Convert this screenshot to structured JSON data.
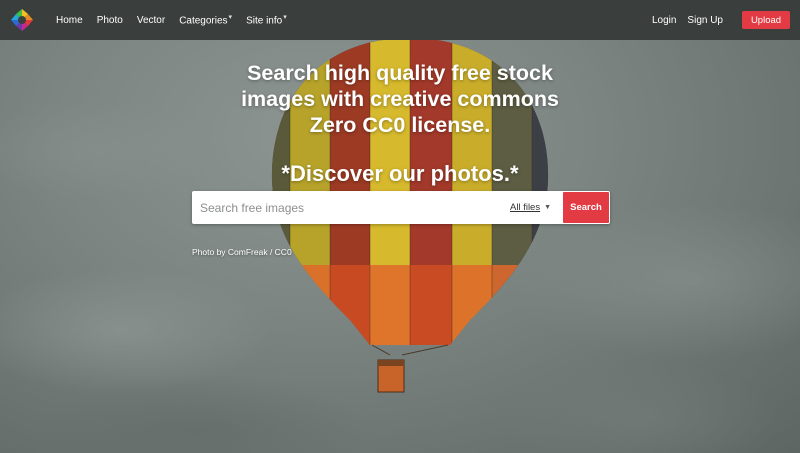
{
  "navbar": {
    "logo_icon": "camera-aperture-icon",
    "left_links": [
      {
        "label": "Home",
        "has_dropdown": false
      },
      {
        "label": "Photo",
        "has_dropdown": false
      },
      {
        "label": "Vector",
        "has_dropdown": false
      },
      {
        "label": "Categories",
        "has_dropdown": true
      },
      {
        "label": "Site info",
        "has_dropdown": true
      }
    ],
    "login_label": "Login",
    "signup_label": "Sign Up",
    "upload_label": "Upload"
  },
  "hero": {
    "title_lines": [
      "Search high quality free stock",
      "images with creative commons",
      "Zero CC0 license."
    ],
    "subtitle": "*Discover our photos.*",
    "search": {
      "placeholder": "Search free images",
      "value": "",
      "filter_label": "All files",
      "button_label": "Search"
    },
    "photo_credit": "Photo by ComFreak / CC0"
  },
  "colors": {
    "navbar_bg": "#3a3e3d",
    "accent": "#e23b44",
    "sky": "#7c8582"
  }
}
